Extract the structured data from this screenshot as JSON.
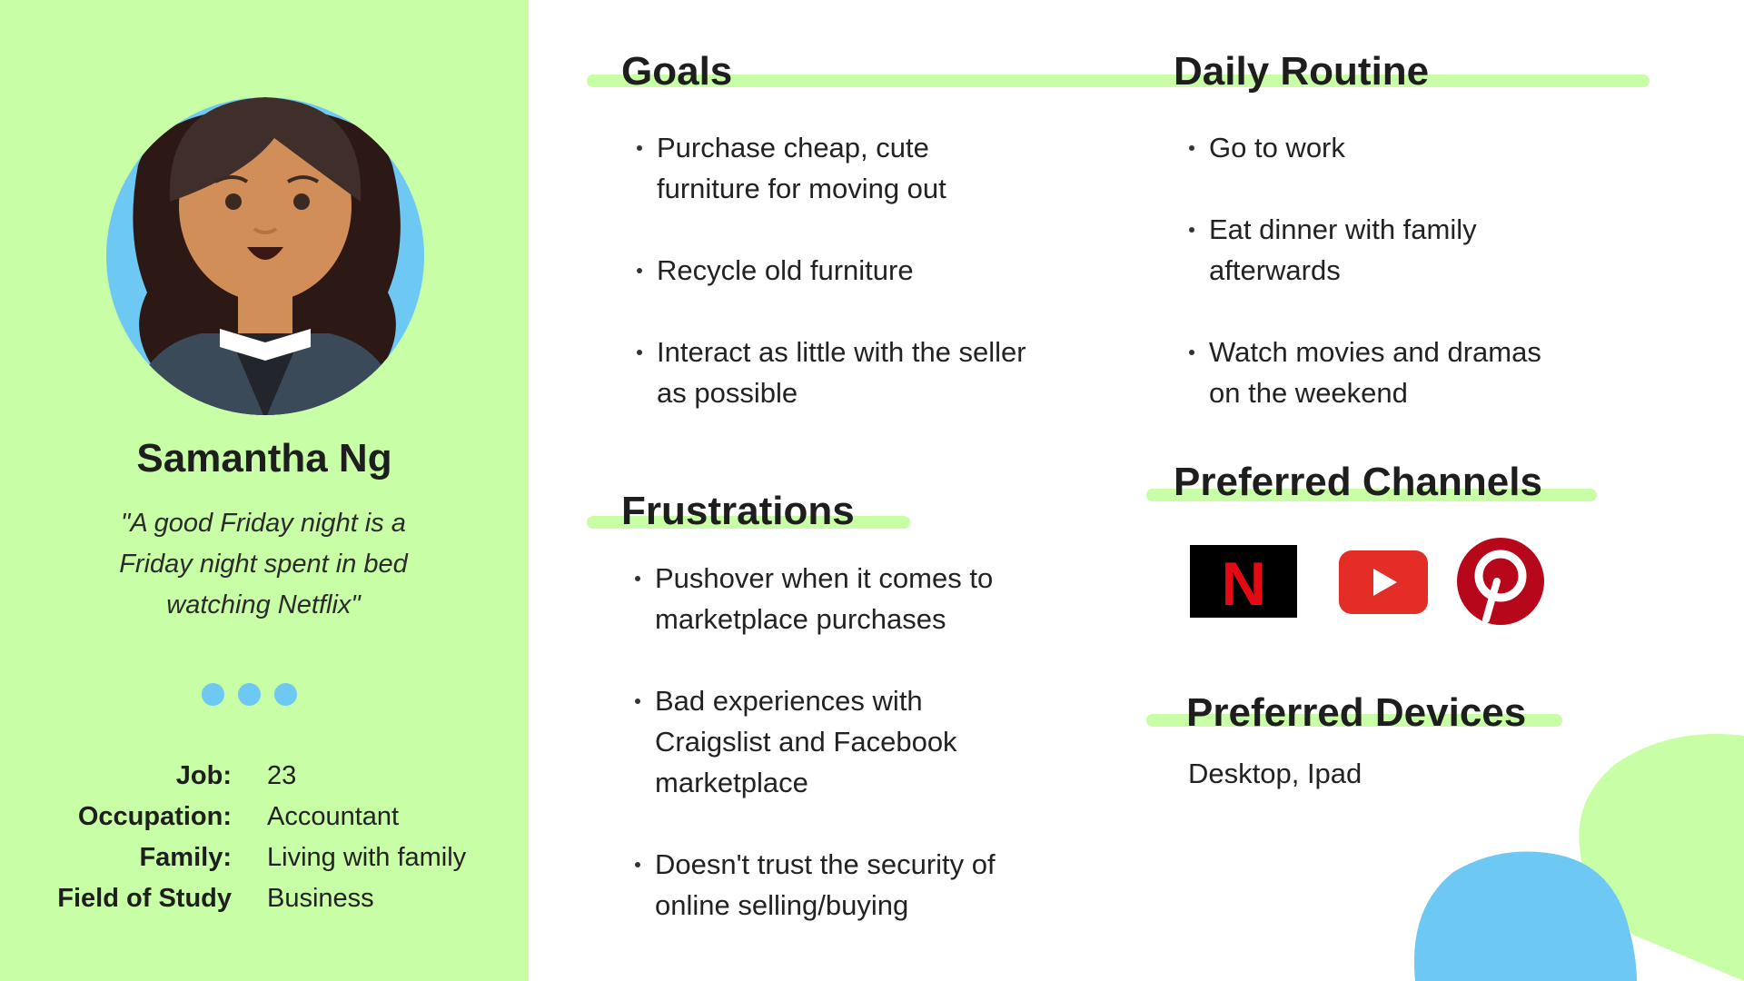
{
  "persona": {
    "name": "Samantha Ng",
    "quote": "\"A good Friday night is a Friday night spent in bed watching Netflix\"",
    "facts": [
      {
        "label": "Job:",
        "value": "23"
      },
      {
        "label": "Occupation:",
        "value": "Accountant"
      },
      {
        "label": "Family:",
        "value": "Living with family"
      },
      {
        "label": "Field of Study",
        "value": "Business"
      }
    ]
  },
  "goals": {
    "title": "Goals",
    "items": [
      "Purchase cheap, cute furniture for moving out",
      "Recycle old furniture",
      "Interact as little with the seller as possible"
    ]
  },
  "frustrations": {
    "title": "Frustrations",
    "items": [
      "Pushover when it comes to marketplace purchases",
      "Bad experiences with Craigslist and Facebook marketplace",
      "Doesn't trust the security of online selling/buying"
    ]
  },
  "daily_routine": {
    "title": "Daily Routine",
    "items": [
      "Go to work",
      "Eat dinner with family afterwards",
      "Watch movies and dramas on the weekend"
    ]
  },
  "preferred_channels": {
    "title": "Preferred Channels",
    "icons": [
      "netflix-logo",
      "youtube-logo",
      "pinterest-logo"
    ],
    "netflix_letter": "N"
  },
  "preferred_devices": {
    "title": "Preferred Devices",
    "text": "Desktop, Ipad"
  },
  "colors": {
    "accent_green": "#c8fea5",
    "accent_blue": "#6ec8f4",
    "text_dark": "#1e1e1e"
  }
}
